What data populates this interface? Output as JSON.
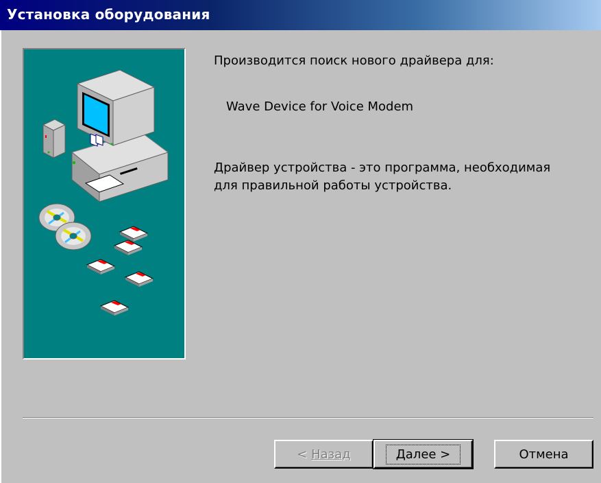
{
  "window": {
    "title": "Установка оборудования"
  },
  "content": {
    "search_text": "Производится поиск нового драйвера для:",
    "device_name": "Wave Device for Voice Modem",
    "description_line1": "Драйвер устройства - это программа, необходимая",
    "description_line2": "для правильной работы устройства."
  },
  "buttons": {
    "back_prefix": "< ",
    "back_label": "Назад",
    "next_label": "Далее >",
    "cancel_label": "Отмена"
  },
  "colors": {
    "title_bar": "#000080",
    "dialog_bg": "#c0c0c0",
    "side_panel": "#008080"
  },
  "icons": {
    "side_panel": [
      "computer-icon",
      "cd-disc-icon",
      "floppy-disk-icon"
    ]
  }
}
